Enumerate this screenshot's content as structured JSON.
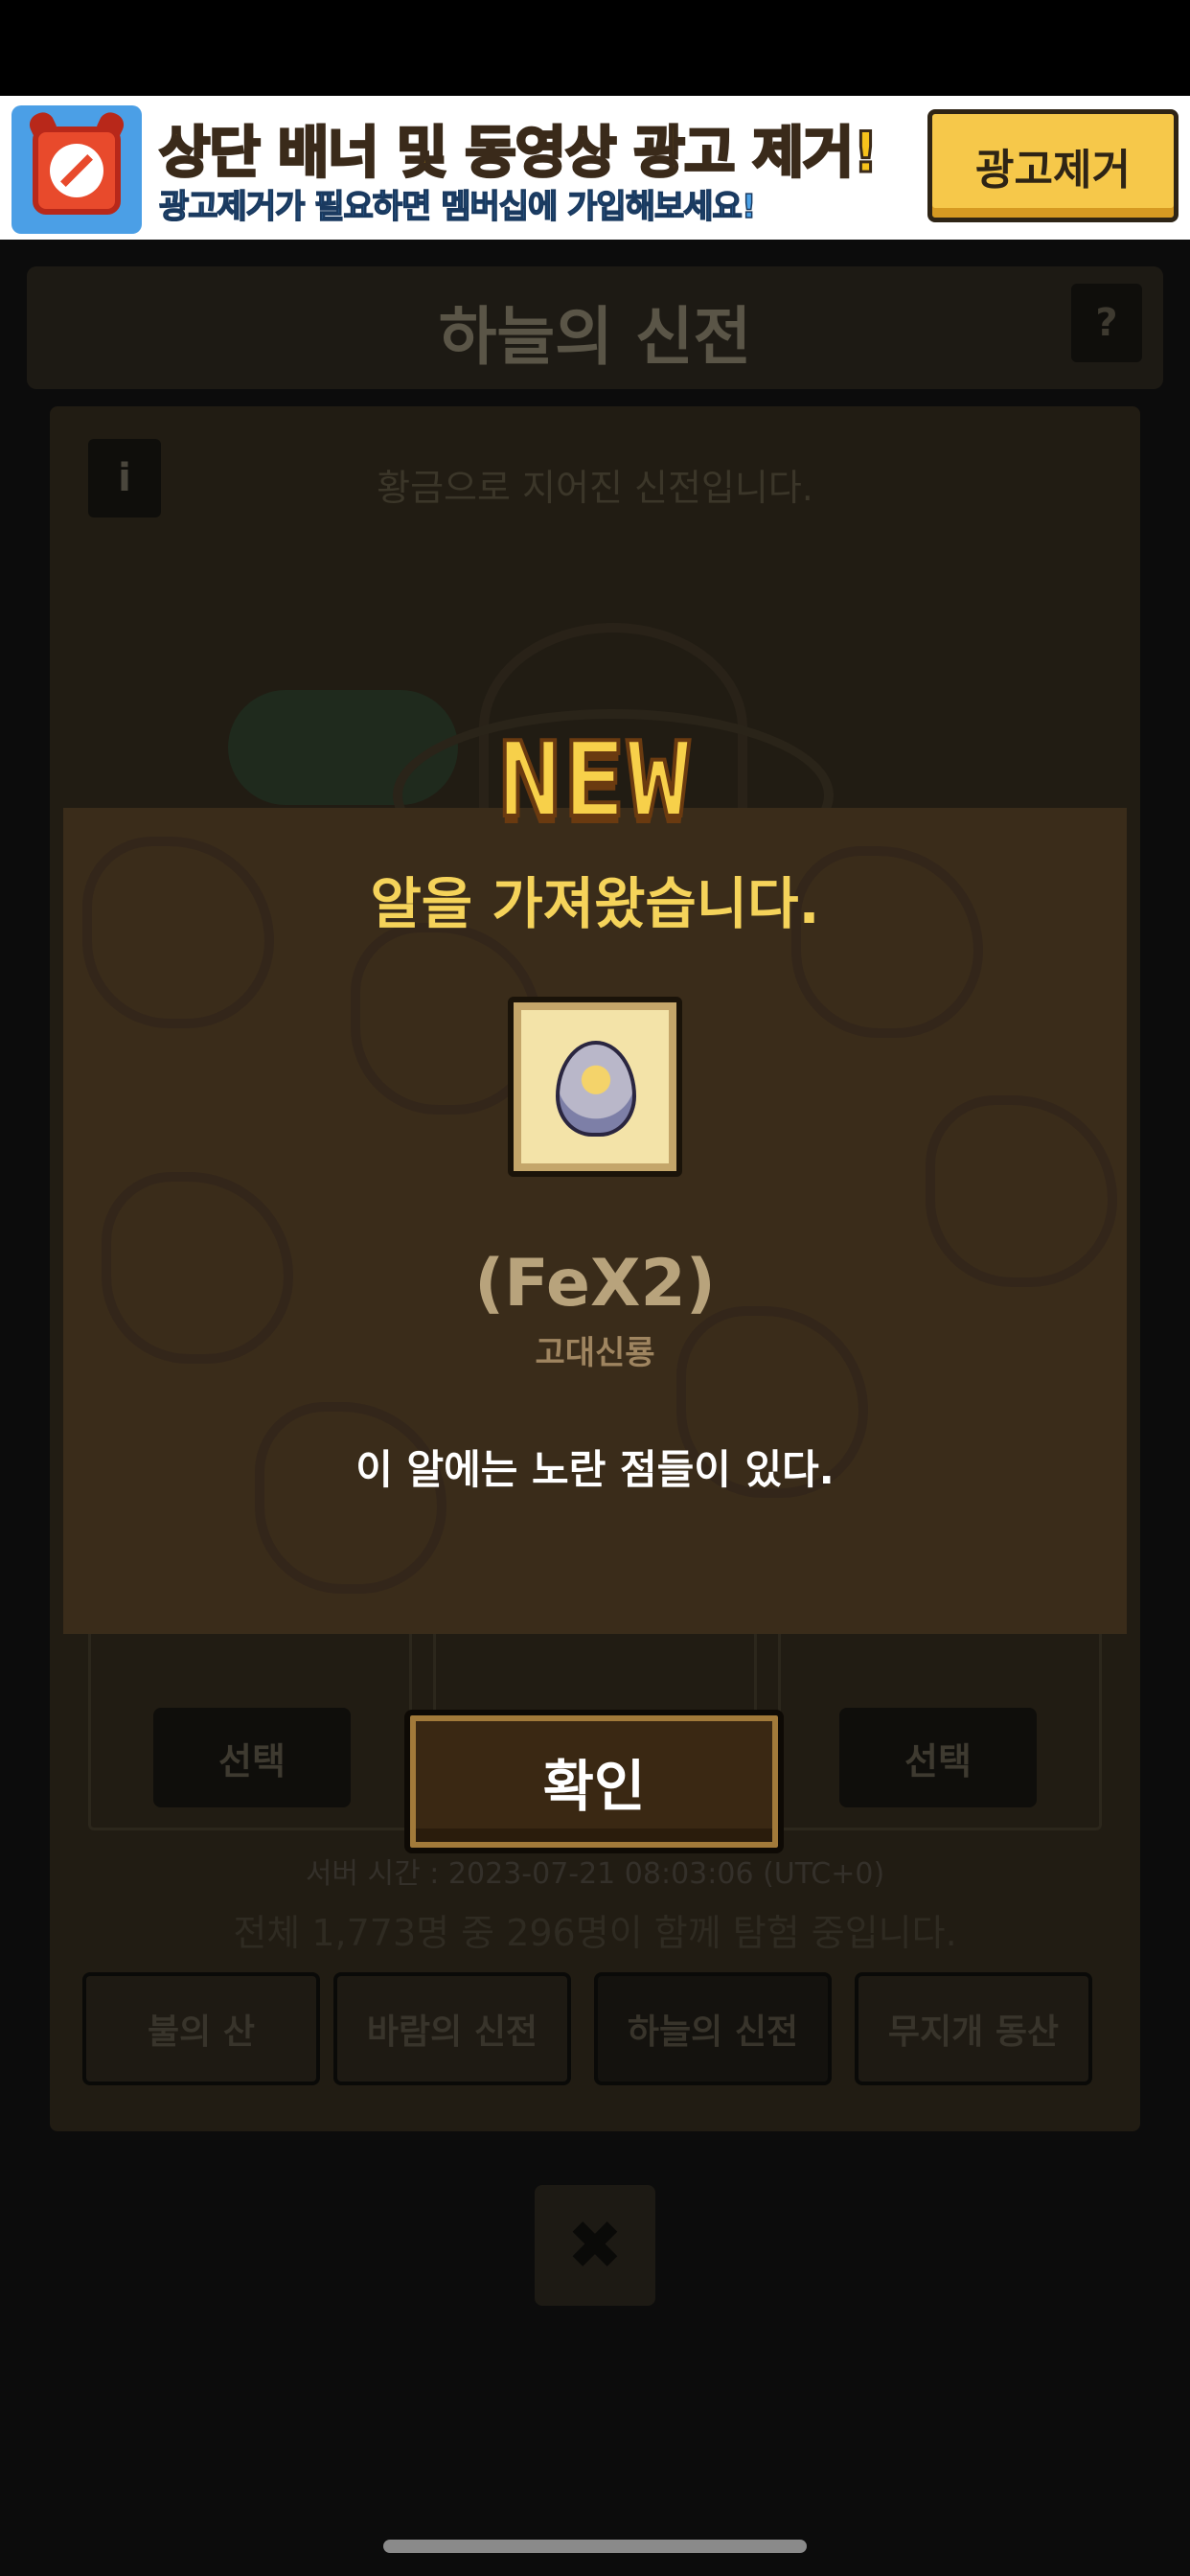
{
  "ad_banner": {
    "title": "상단 배너 및 동영상 광고 제거!",
    "subtitle": "광고제거가 필요하면 멤버십에 가입해보세요!",
    "remove_button": "광고제거",
    "icon": "no-ads-clock-icon"
  },
  "header": {
    "title": "하늘의 신전",
    "help_label": "?"
  },
  "panel": {
    "info_label": "i",
    "description": "황금으로 지어진 신전입니다.",
    "select_buttons": [
      "선택",
      "선택"
    ],
    "server_time": "서버 시간 : 2023-07-21 08:03:06 (UTC+0)",
    "explorers": "전체 1,773명 중 296명이 함께 탐험 중입니다.",
    "map_tabs": [
      "불의 산",
      "바람의 신전",
      "하늘의 신전",
      "무지개 동산"
    ],
    "active_tab": "하늘의 신전"
  },
  "modal": {
    "badge": "NEW",
    "title": "알을 가져왔습니다.",
    "egg_icon": "egg-icon",
    "egg_name": "(FeX2)",
    "egg_type": "고대신룡",
    "egg_description": "이 알에는 노란 점들이 있다.",
    "confirm_button": "확인"
  },
  "close_icon": "close-icon",
  "colors": {
    "ad_title": "#f7c21c",
    "ad_subtitle": "#4da3e8",
    "ad_button": "#f6c84a",
    "modal_title": "#f5d35a",
    "egg_name": "#b8a37c",
    "modal_band": "#3a2c1a"
  }
}
